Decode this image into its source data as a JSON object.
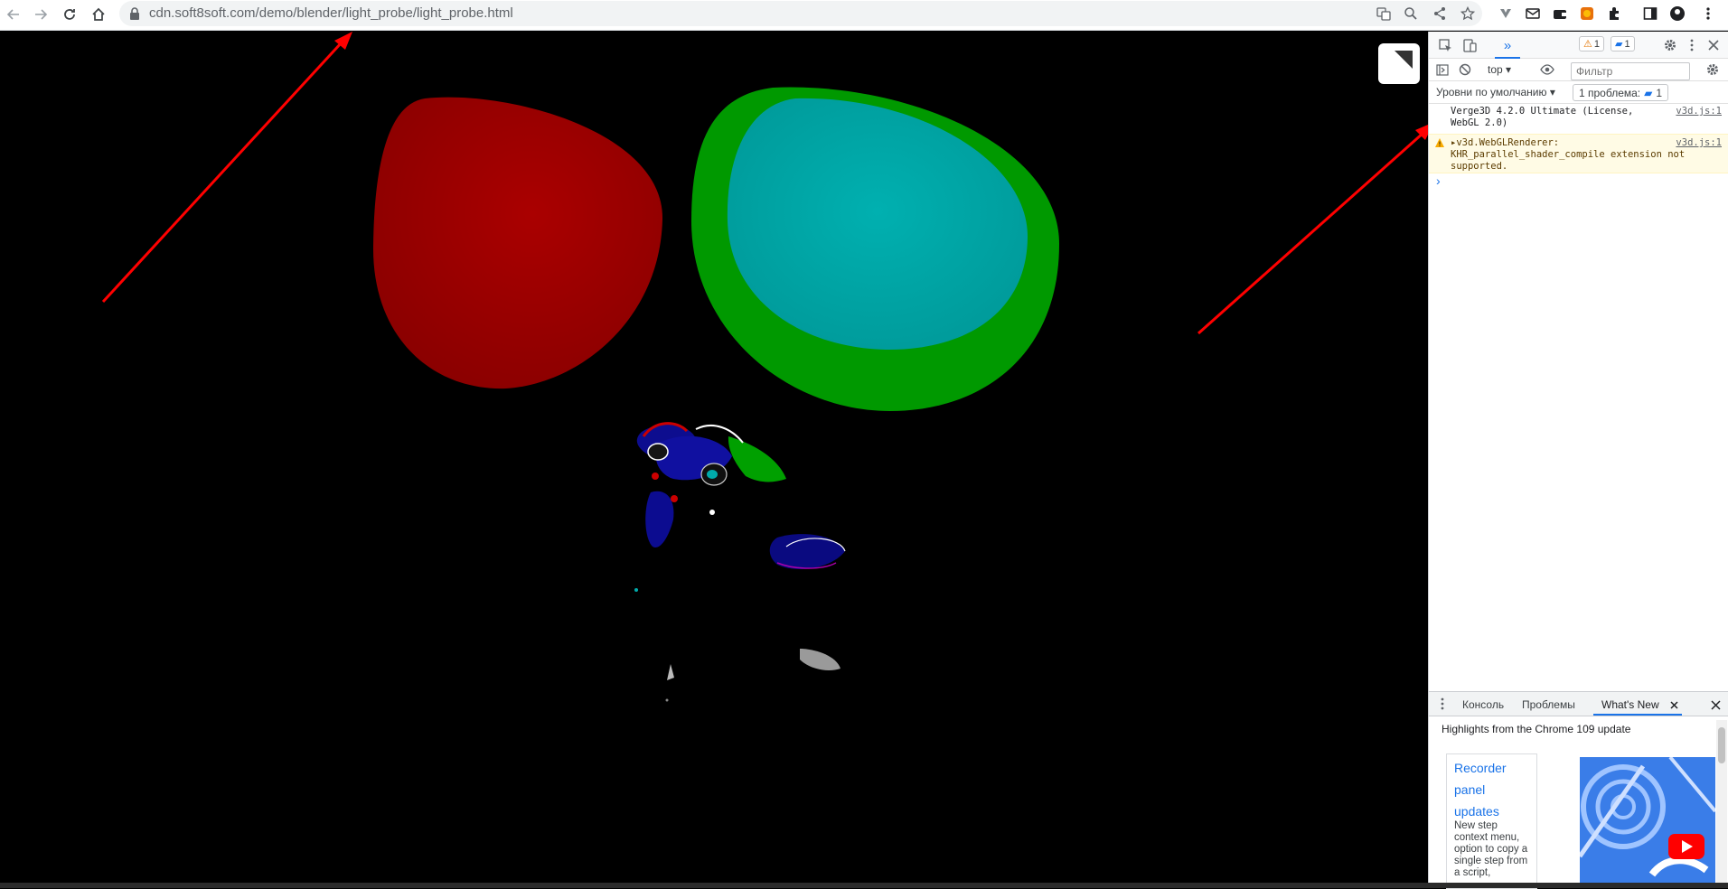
{
  "browser": {
    "url": "cdn.soft8soft.com/demo/blender/light_probe/light_probe.html"
  },
  "devtools": {
    "tab_overflow": "»",
    "warn_count": "1",
    "info_count": "1",
    "context": "top",
    "filter_placeholder": "Фильтр",
    "levels_label": "Уровни по умолчанию",
    "issues_label": "1 проблема:",
    "issues_count": "1",
    "messages": [
      {
        "text": "Verge3D 4.2.0 Ultimate (License, WebGL 2.0)",
        "source": "v3d.js:1",
        "level": "info"
      },
      {
        "text": "▸v3d.WebGLRenderer: KHR_parallel_shader_compile extension not supported.",
        "source": "v3d.js:1",
        "level": "warning"
      }
    ],
    "drawer": {
      "tabs": [
        "Консоль",
        "Проблемы",
        "What's New"
      ],
      "active_tab": "What's New",
      "heading": "Highlights from the Chrome 109 update",
      "card_title": "Recorder panel updates",
      "card_desc": "New step context menu, option to copy a single step from a script,"
    }
  },
  "colors": {
    "accent": "#1a73e8",
    "warning_bg": "#fffbe5",
    "annotation_arrow": "#ff0000",
    "red_sphere": "#990000",
    "green_sphere": "#009900",
    "cyan_sphere": "#00a6a6"
  }
}
